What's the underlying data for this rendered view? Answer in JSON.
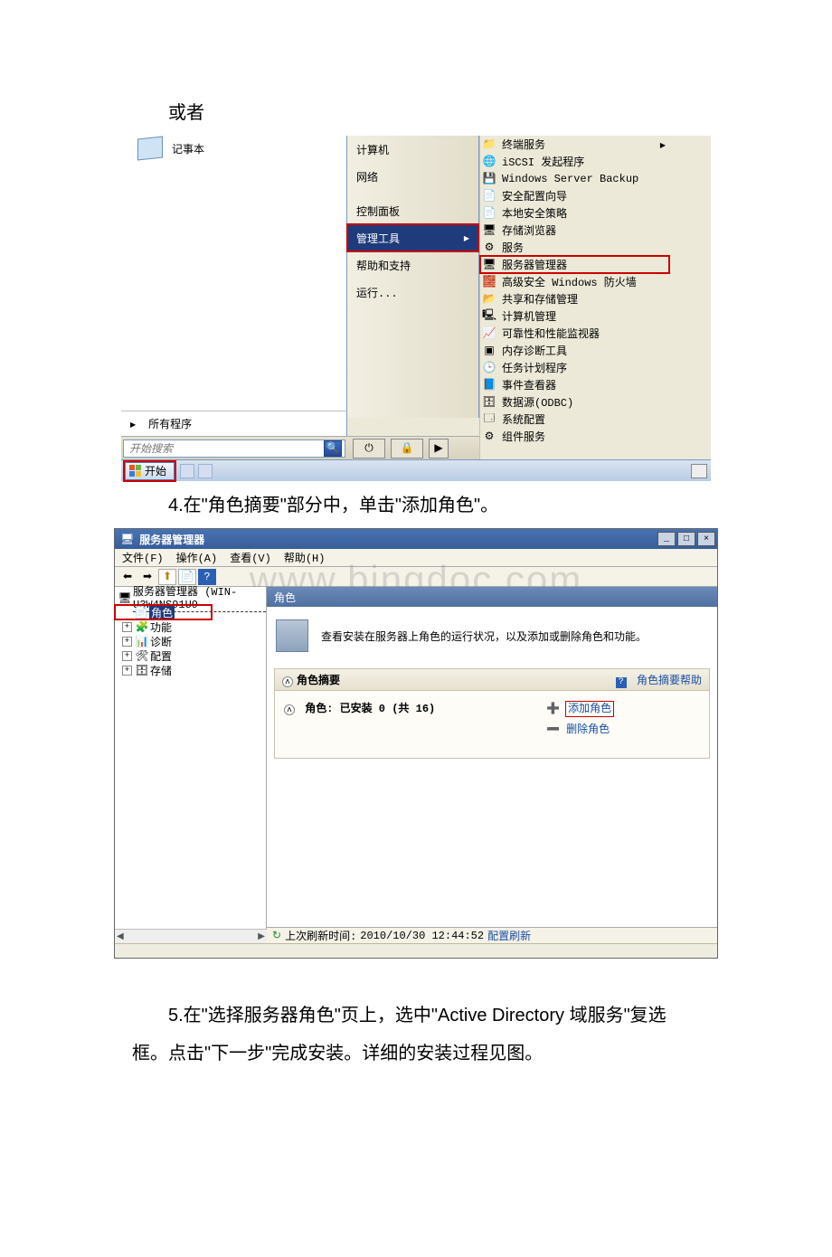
{
  "doc": {
    "p_or": "或者",
    "p_step4": "4.在\"角色摘要\"部分中，单击\"添加角色\"。",
    "p_step5a": "5.在\"选择服务器角色\"页上，选中\"Active Directory 域服务\"复选",
    "p_step5b": "框。点击\"下一步\"完成安装。详细的安装过程见图。"
  },
  "startmenu": {
    "left_item": "记事本",
    "all_programs": "所有程序",
    "search_placeholder": "开始搜索",
    "mid": {
      "computer": "计算机",
      "network": "网络",
      "control_panel": "控制面板",
      "admin_tools": "管理工具",
      "help": "帮助和支持",
      "run": "运行..."
    },
    "admin": {
      "terminal": "终端服务",
      "iscsi": "iSCSI 发起程序",
      "wsb": "Windows Server Backup",
      "secwiz": "安全配置向导",
      "localsec": "本地安全策略",
      "storage": "存储浏览器",
      "services": "服务",
      "srvmgr": "服务器管理器",
      "firewall": "高级安全 Windows 防火墙",
      "share": "共享和存储管理",
      "compmgmt": "计算机管理",
      "perfmon": "可靠性和性能监视器",
      "memdiag": "内存诊断工具",
      "tasksched": "任务计划程序",
      "eventvwr": "事件查看器",
      "odbc": "数据源(ODBC)",
      "sysconfig": "系统配置",
      "compsvc": "组件服务"
    },
    "taskbar": {
      "start": "开始"
    }
  },
  "srvmgr": {
    "title": "服务器管理器",
    "menus": {
      "file": "文件(F)",
      "action": "操作(A)",
      "view": "查看(V)",
      "help": "帮助(H)"
    },
    "tree": {
      "root": "服务器管理器 (WIN-U3W4NS91U9",
      "roles": "角色",
      "features": "功能",
      "diag": "诊断",
      "config": "配置",
      "storage": "存储"
    },
    "content": {
      "header": "角色",
      "desc": "查看安装在服务器上角色的运行状况，以及添加或删除角色和功能。",
      "panel_title": "角色摘要",
      "panel_help": "角色摘要帮助",
      "installed": "角色: 已安装 0 (共 16)",
      "add_role": "添加角色",
      "remove_role": "删除角色"
    },
    "status": {
      "prefix": "上次刷新时间: ",
      "time": "2010/10/30 12:44:52",
      "refresh": "配置刷新"
    },
    "watermark": "www.bingdoc.com"
  }
}
